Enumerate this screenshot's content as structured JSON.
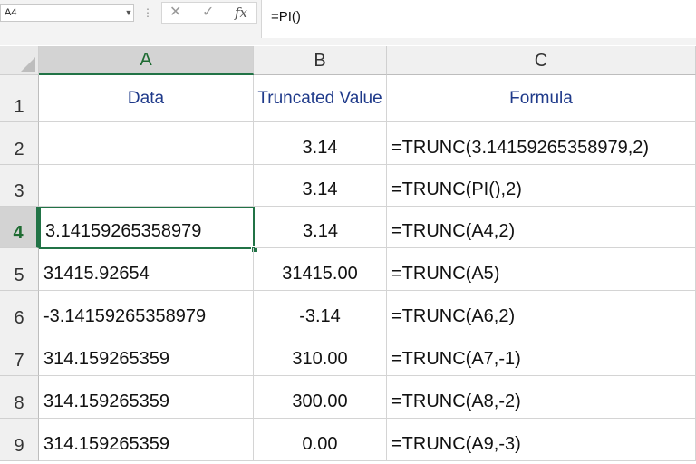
{
  "formula_bar": {
    "name_box": "A4",
    "cancel_icon": "✕",
    "enter_icon": "✓",
    "fx_label": "fx",
    "formula": "=PI()"
  },
  "columns": [
    "A",
    "B",
    "C"
  ],
  "rows": [
    {
      "num": "1",
      "a": "Data",
      "b": "Truncated Value",
      "c": "Formula"
    },
    {
      "num": "2",
      "a": "",
      "b": "3.14",
      "c": "=TRUNC(3.14159265358979,2)"
    },
    {
      "num": "3",
      "a": "",
      "b": "3.14",
      "c": "=TRUNC(PI(),2)"
    },
    {
      "num": "4",
      "a": "3.14159265358979",
      "b": "3.14",
      "c": "=TRUNC(A4,2)"
    },
    {
      "num": "5",
      "a": "31415.92654",
      "b": "31415.00",
      "c": "=TRUNC(A5)"
    },
    {
      "num": "6",
      "a": "-3.14159265358979",
      "b": "-3.14",
      "c": "=TRUNC(A6,2)"
    },
    {
      "num": "7",
      "a": "314.159265359",
      "b": "310.00",
      "c": "=TRUNC(A7,-1)"
    },
    {
      "num": "8",
      "a": "314.159265359",
      "b": "300.00",
      "c": "=TRUNC(A8,-2)"
    },
    {
      "num": "9",
      "a": "314.159265359",
      "b": "0.00",
      "c": "=TRUNC(A9,-3)"
    }
  ],
  "active_cell": "A4",
  "colors": {
    "accent": "#217346",
    "header_text": "#1f3a8a"
  }
}
